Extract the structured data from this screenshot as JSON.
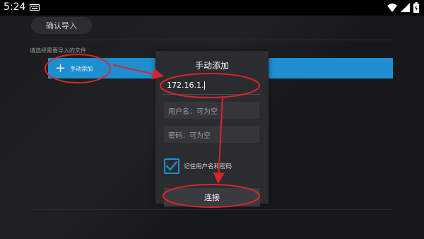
{
  "status_bar": {
    "time": "5:24",
    "icons": [
      "keyboard-icon",
      "wifi-icon",
      "signal-icon",
      "battery-icon"
    ]
  },
  "background": {
    "confirm_import_label": "确认导入",
    "select_label": "请选择需要导入的文件",
    "manual_add_label": "手动添加",
    "file_bar_color": "#1d8ed0"
  },
  "dialog": {
    "title": "手动添加",
    "ip_value": "172.16.1.",
    "username_placeholder": "用户名：可为空",
    "password_placeholder": "密码：可为空",
    "remember_label": "记住用户名和密码",
    "remember_checked": true,
    "connect_label": "连接"
  },
  "annotations": {
    "color": "#d9252a"
  }
}
